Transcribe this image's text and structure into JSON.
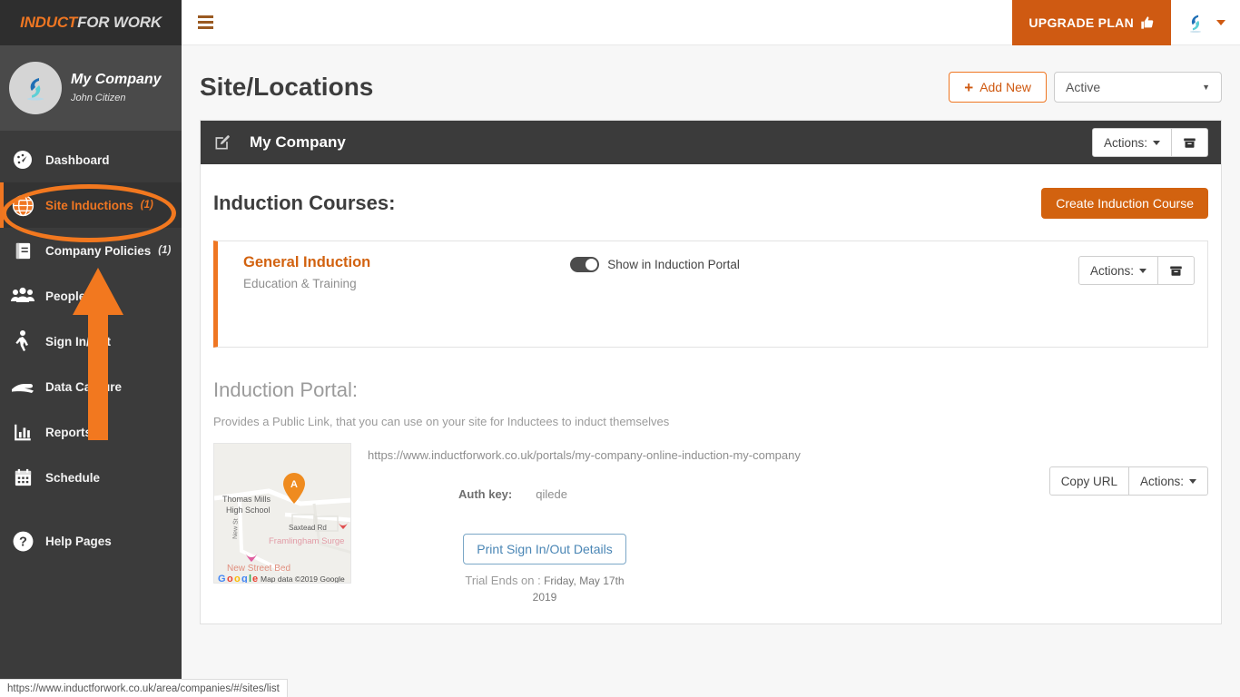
{
  "brand": {
    "part1": "INDUCT",
    "part2": "FOR WORK"
  },
  "profile": {
    "company": "My Company",
    "user": "John Citizen",
    "avatar_icon": "company-logo-icon"
  },
  "sidebar": {
    "items": [
      {
        "label": "Dashboard",
        "badge": "",
        "icon": "speedometer-icon",
        "active": false
      },
      {
        "label": "Site Inductions",
        "badge": "(1)",
        "icon": "globe-icon",
        "active": true
      },
      {
        "label": "Company Policies",
        "badge": "(1)",
        "icon": "book-icon",
        "active": false
      },
      {
        "label": "People",
        "badge": "",
        "icon": "people-icon",
        "active": false
      },
      {
        "label": "Sign In/Out",
        "badge": "",
        "icon": "walking-person-icon",
        "active": false
      },
      {
        "label": "Data Capture",
        "badge": "",
        "icon": "hand-icon",
        "active": false
      },
      {
        "label": "Reports",
        "badge": "",
        "icon": "bar-chart-icon",
        "active": false
      },
      {
        "label": "Schedule",
        "badge": "",
        "icon": "calendar-icon",
        "active": false
      },
      {
        "label": "Help Pages",
        "badge": "",
        "icon": "question-mark-icon",
        "active": false
      }
    ]
  },
  "topbar": {
    "menu_icon": "hamburger-icon",
    "upgrade_label": "UPGRADE PLAN",
    "upgrade_icon": "thumbs-up-icon",
    "user_icon": "user-logo-icon",
    "caret_icon": "chevron-down-icon"
  },
  "page": {
    "title": "Site/Locations",
    "add_new_label": "Add New",
    "add_new_plus": "+",
    "status_filter": "Active"
  },
  "panel": {
    "edit_icon": "edit-pencil-icon",
    "title": "My Company",
    "actions_label": "Actions:",
    "archive_icon": "archive-box-icon"
  },
  "courses_section": {
    "title": "Induction Courses:",
    "create_label": "Create Induction Course",
    "items": [
      {
        "title": "General Induction",
        "subtitle": "Education & Training",
        "toggle_label": "Show in Induction Portal",
        "toggle_on": true,
        "actions_label": "Actions:",
        "archive_icon": "archive-box-icon"
      }
    ]
  },
  "portal": {
    "title": "Induction Portal:",
    "description": "Provides a Public Link, that you can use on your site for Inductees to induct themselves",
    "url": "https://www.inductforwork.co.uk/portals/my-company-online-induction-my-company",
    "auth_key_label": "Auth key:",
    "auth_key_value": "qilede",
    "print_label": "Print Sign In/Out Details",
    "trial_prefix": "Trial Ends on :",
    "trial_date": "Friday, May 17th 2019",
    "copy_url_label": "Copy URL",
    "actions_label": "Actions:",
    "map": {
      "marker_label": "A",
      "labels": [
        "Thomas Mills",
        "High School",
        "New St",
        "Saxtead Rd",
        "Framlingham Surge",
        "New Street Bed"
      ],
      "attribution": "Map data ©2019 Google",
      "logo": "Google"
    }
  },
  "statusbar": {
    "url": "https://www.inductforwork.co.uk/area/companies/#/sites/list"
  },
  "annotations": {
    "highlight_target": "Site Inductions",
    "arrow_color": "#f2781f",
    "ellipse_color": "#f2781f"
  },
  "colors": {
    "accent_orange": "#ef7622",
    "dark_orange": "#cf5a12",
    "sidebar_bg": "#3b3b3b",
    "panel_dark": "#3b3b3b"
  }
}
